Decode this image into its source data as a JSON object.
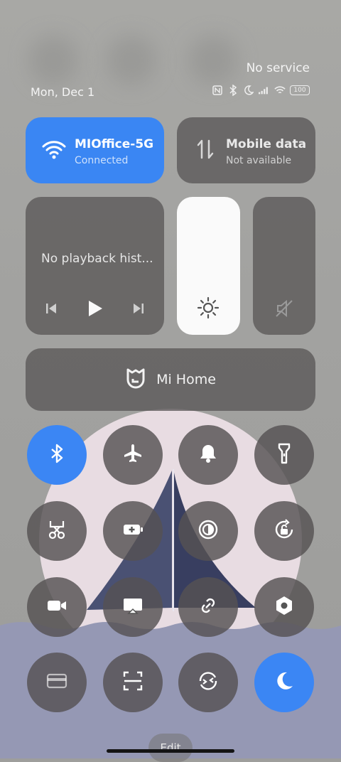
{
  "status_bar": {
    "carrier_text": "No service",
    "date": "Mon, Dec 1",
    "battery_level": "100",
    "icons": [
      "nfc-icon",
      "bluetooth-icon",
      "moon-icon",
      "signal-icon",
      "wifi-icon",
      "battery-icon"
    ]
  },
  "wifi": {
    "title": "MIOffice-5G",
    "subtitle": "Connected",
    "accent": "#3a86f3",
    "active": true
  },
  "mobile_data": {
    "title": "Mobile data",
    "subtitle": "Not available",
    "active": false
  },
  "media": {
    "text": "No playback hist...",
    "icons": [
      "previous-icon",
      "play-icon",
      "next-icon"
    ]
  },
  "brightness": {
    "icon": "sun-icon",
    "level_percent": 100
  },
  "volume": {
    "icon": "mute-icon",
    "level_percent": 0
  },
  "mi_home": {
    "label": "Mi Home",
    "icon": "mi-home-icon"
  },
  "toggles": [
    {
      "name": "bluetooth",
      "icon": "bluetooth-icon",
      "active": true
    },
    {
      "name": "airplane",
      "icon": "airplane-icon",
      "active": false
    },
    {
      "name": "sound",
      "icon": "bell-icon",
      "active": false
    },
    {
      "name": "flashlight",
      "icon": "flashlight-icon",
      "active": false
    },
    {
      "name": "screenshot",
      "icon": "scissors-icon",
      "active": false
    },
    {
      "name": "battery-saver",
      "icon": "battery-plus-icon",
      "active": false
    },
    {
      "name": "reading-mode",
      "icon": "contrast-icon",
      "active": false
    },
    {
      "name": "auto-rotate",
      "icon": "rotate-lock-icon",
      "active": false
    },
    {
      "name": "screen-recorder",
      "icon": "video-camera-icon",
      "active": false
    },
    {
      "name": "cast",
      "icon": "cast-icon",
      "active": false
    },
    {
      "name": "link",
      "icon": "link-icon",
      "active": false
    },
    {
      "name": "settings",
      "icon": "hexagon-icon",
      "active": false
    },
    {
      "name": "cards",
      "icon": "card-icon",
      "active": false
    },
    {
      "name": "scanner",
      "icon": "scan-icon",
      "active": false
    },
    {
      "name": "sync",
      "icon": "sync-icon",
      "active": false
    },
    {
      "name": "dark-mode",
      "icon": "moon-icon",
      "active": true
    }
  ],
  "edit_label": "Edit"
}
